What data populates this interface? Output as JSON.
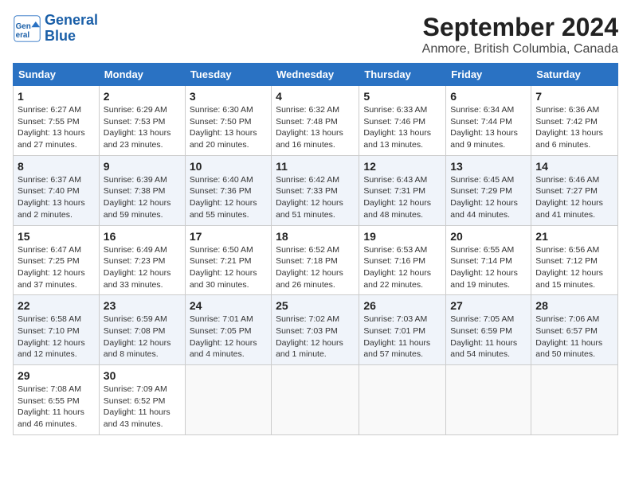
{
  "logo": {
    "line1": "General",
    "line2": "Blue"
  },
  "title": "September 2024",
  "subtitle": "Anmore, British Columbia, Canada",
  "days_of_week": [
    "Sunday",
    "Monday",
    "Tuesday",
    "Wednesday",
    "Thursday",
    "Friday",
    "Saturday"
  ],
  "weeks": [
    [
      {
        "num": "1",
        "sunrise": "6:27 AM",
        "sunset": "7:55 PM",
        "daylight": "13 hours and 27 minutes."
      },
      {
        "num": "2",
        "sunrise": "6:29 AM",
        "sunset": "7:53 PM",
        "daylight": "13 hours and 23 minutes."
      },
      {
        "num": "3",
        "sunrise": "6:30 AM",
        "sunset": "7:50 PM",
        "daylight": "13 hours and 20 minutes."
      },
      {
        "num": "4",
        "sunrise": "6:32 AM",
        "sunset": "7:48 PM",
        "daylight": "13 hours and 16 minutes."
      },
      {
        "num": "5",
        "sunrise": "6:33 AM",
        "sunset": "7:46 PM",
        "daylight": "13 hours and 13 minutes."
      },
      {
        "num": "6",
        "sunrise": "6:34 AM",
        "sunset": "7:44 PM",
        "daylight": "13 hours and 9 minutes."
      },
      {
        "num": "7",
        "sunrise": "6:36 AM",
        "sunset": "7:42 PM",
        "daylight": "13 hours and 6 minutes."
      }
    ],
    [
      {
        "num": "8",
        "sunrise": "6:37 AM",
        "sunset": "7:40 PM",
        "daylight": "13 hours and 2 minutes."
      },
      {
        "num": "9",
        "sunrise": "6:39 AM",
        "sunset": "7:38 PM",
        "daylight": "12 hours and 59 minutes."
      },
      {
        "num": "10",
        "sunrise": "6:40 AM",
        "sunset": "7:36 PM",
        "daylight": "12 hours and 55 minutes."
      },
      {
        "num": "11",
        "sunrise": "6:42 AM",
        "sunset": "7:33 PM",
        "daylight": "12 hours and 51 minutes."
      },
      {
        "num": "12",
        "sunrise": "6:43 AM",
        "sunset": "7:31 PM",
        "daylight": "12 hours and 48 minutes."
      },
      {
        "num": "13",
        "sunrise": "6:45 AM",
        "sunset": "7:29 PM",
        "daylight": "12 hours and 44 minutes."
      },
      {
        "num": "14",
        "sunrise": "6:46 AM",
        "sunset": "7:27 PM",
        "daylight": "12 hours and 41 minutes."
      }
    ],
    [
      {
        "num": "15",
        "sunrise": "6:47 AM",
        "sunset": "7:25 PM",
        "daylight": "12 hours and 37 minutes."
      },
      {
        "num": "16",
        "sunrise": "6:49 AM",
        "sunset": "7:23 PM",
        "daylight": "12 hours and 33 minutes."
      },
      {
        "num": "17",
        "sunrise": "6:50 AM",
        "sunset": "7:21 PM",
        "daylight": "12 hours and 30 minutes."
      },
      {
        "num": "18",
        "sunrise": "6:52 AM",
        "sunset": "7:18 PM",
        "daylight": "12 hours and 26 minutes."
      },
      {
        "num": "19",
        "sunrise": "6:53 AM",
        "sunset": "7:16 PM",
        "daylight": "12 hours and 22 minutes."
      },
      {
        "num": "20",
        "sunrise": "6:55 AM",
        "sunset": "7:14 PM",
        "daylight": "12 hours and 19 minutes."
      },
      {
        "num": "21",
        "sunrise": "6:56 AM",
        "sunset": "7:12 PM",
        "daylight": "12 hours and 15 minutes."
      }
    ],
    [
      {
        "num": "22",
        "sunrise": "6:58 AM",
        "sunset": "7:10 PM",
        "daylight": "12 hours and 12 minutes."
      },
      {
        "num": "23",
        "sunrise": "6:59 AM",
        "sunset": "7:08 PM",
        "daylight": "12 hours and 8 minutes."
      },
      {
        "num": "24",
        "sunrise": "7:01 AM",
        "sunset": "7:05 PM",
        "daylight": "12 hours and 4 minutes."
      },
      {
        "num": "25",
        "sunrise": "7:02 AM",
        "sunset": "7:03 PM",
        "daylight": "12 hours and 1 minute."
      },
      {
        "num": "26",
        "sunrise": "7:03 AM",
        "sunset": "7:01 PM",
        "daylight": "11 hours and 57 minutes."
      },
      {
        "num": "27",
        "sunrise": "7:05 AM",
        "sunset": "6:59 PM",
        "daylight": "11 hours and 54 minutes."
      },
      {
        "num": "28",
        "sunrise": "7:06 AM",
        "sunset": "6:57 PM",
        "daylight": "11 hours and 50 minutes."
      }
    ],
    [
      {
        "num": "29",
        "sunrise": "7:08 AM",
        "sunset": "6:55 PM",
        "daylight": "11 hours and 46 minutes."
      },
      {
        "num": "30",
        "sunrise": "7:09 AM",
        "sunset": "6:52 PM",
        "daylight": "11 hours and 43 minutes."
      },
      null,
      null,
      null,
      null,
      null
    ]
  ]
}
